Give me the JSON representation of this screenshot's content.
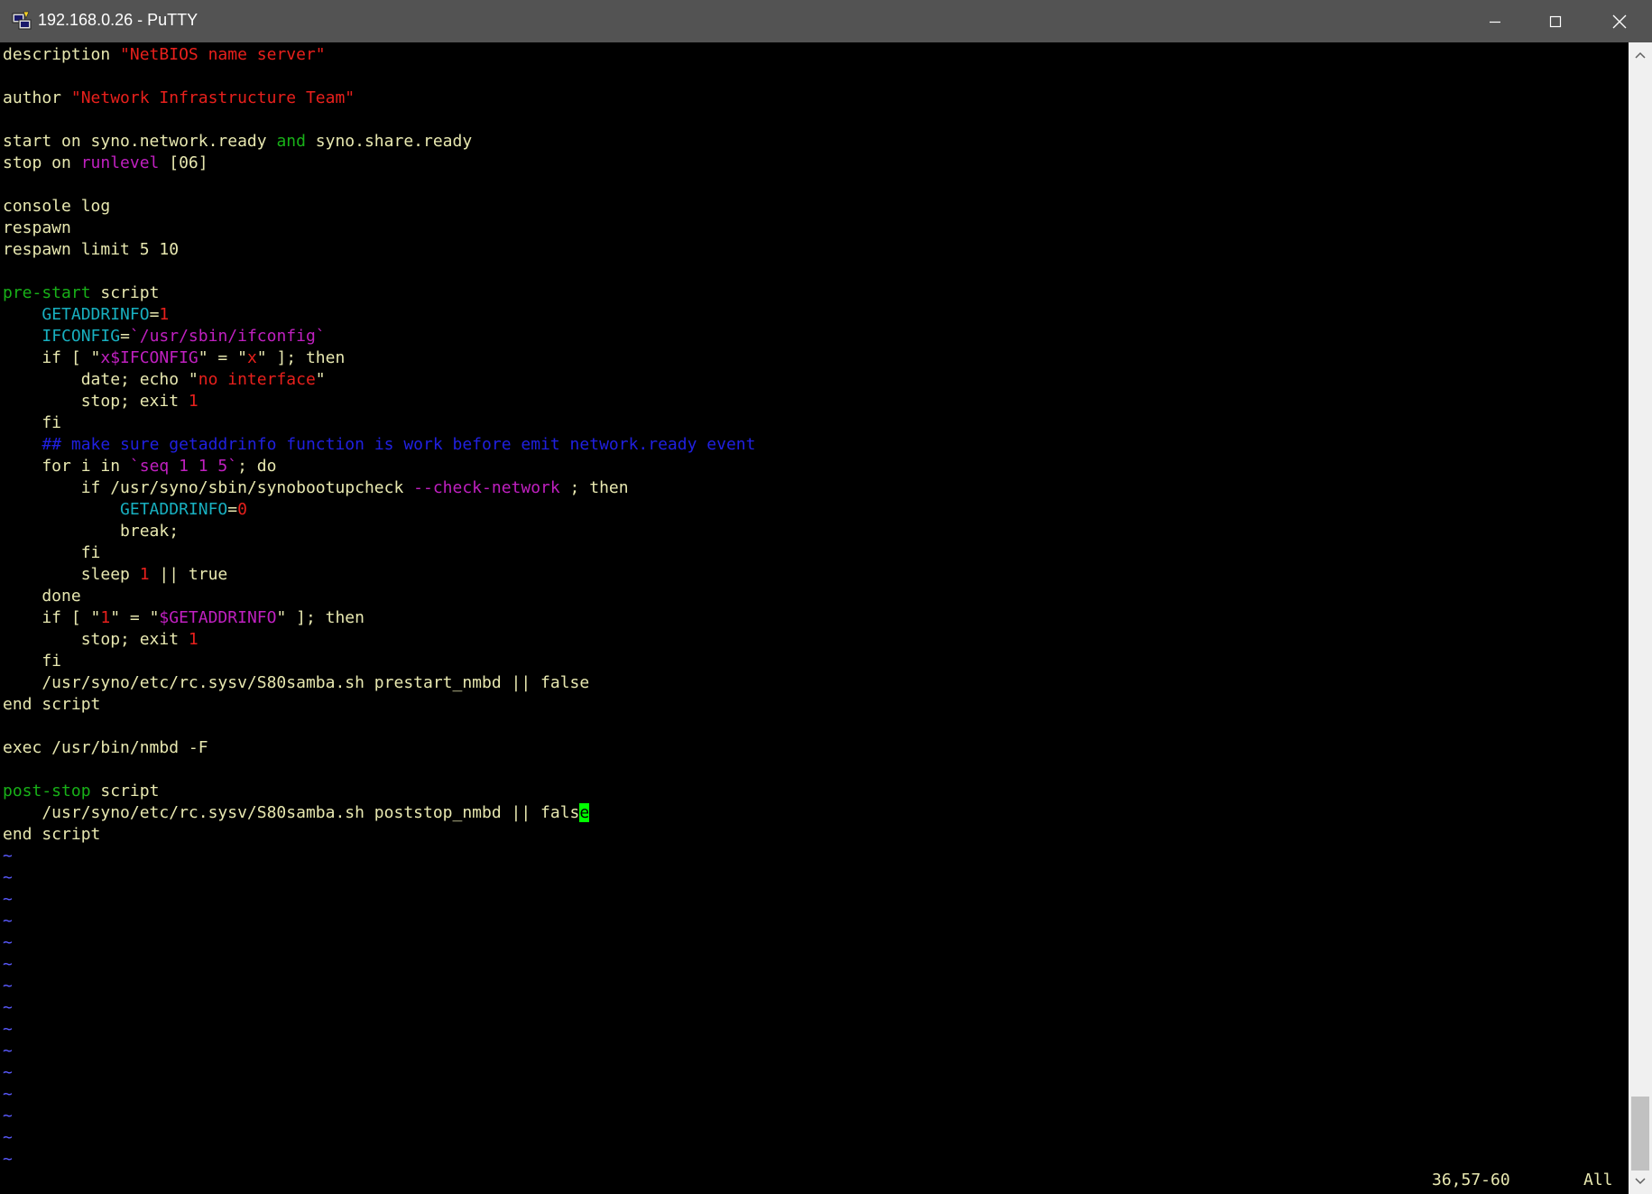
{
  "window": {
    "title": "192.168.0.26 - PuTTY",
    "icon": "putty-icon"
  },
  "colors": {
    "background": "#000000",
    "default_text": "#e8e8b0",
    "string": "#e8201c",
    "keyword_green": "#18b018",
    "keyword_magenta": "#c020c0",
    "variable_cyan": "#18b0c0",
    "comment_blue": "#2020e0",
    "tilde_blue": "#5a5aff",
    "cursor": "#00ff00",
    "titlebar": "#535353"
  },
  "editor": {
    "lines": [
      [
        {
          "t": "description ",
          "c": "d"
        },
        {
          "t": "\"NetBIOS name server\"",
          "c": "s"
        }
      ],
      [],
      [
        {
          "t": "author ",
          "c": "d"
        },
        {
          "t": "\"Network Infrastructure Team\"",
          "c": "s"
        }
      ],
      [],
      [
        {
          "t": "start on syno.network.ready ",
          "c": "d"
        },
        {
          "t": "and",
          "c": "g"
        },
        {
          "t": " syno.share.ready",
          "c": "d"
        }
      ],
      [
        {
          "t": "stop on ",
          "c": "d"
        },
        {
          "t": "runlevel",
          "c": "m"
        },
        {
          "t": " [06]",
          "c": "d"
        }
      ],
      [],
      [
        {
          "t": "console log",
          "c": "d"
        }
      ],
      [
        {
          "t": "respawn",
          "c": "d"
        }
      ],
      [
        {
          "t": "respawn limit 5 10",
          "c": "d"
        }
      ],
      [],
      [
        {
          "t": "pre-start",
          "c": "g"
        },
        {
          "t": " script",
          "c": "d"
        }
      ],
      [
        {
          "t": "    ",
          "c": "d"
        },
        {
          "t": "GETADDRINFO",
          "c": "c"
        },
        {
          "t": "=",
          "c": "d"
        },
        {
          "t": "1",
          "c": "s"
        }
      ],
      [
        {
          "t": "    ",
          "c": "d"
        },
        {
          "t": "IFCONFIG",
          "c": "c"
        },
        {
          "t": "=",
          "c": "d"
        },
        {
          "t": "`/usr/sbin/ifconfig`",
          "c": "m"
        }
      ],
      [
        {
          "t": "    if [ \"",
          "c": "d"
        },
        {
          "t": "x$IFCONFIG",
          "c": "m"
        },
        {
          "t": "\" = \"",
          "c": "d"
        },
        {
          "t": "x",
          "c": "s"
        },
        {
          "t": "\" ]; then",
          "c": "d"
        }
      ],
      [
        {
          "t": "        date; echo \"",
          "c": "d"
        },
        {
          "t": "no interface",
          "c": "s"
        },
        {
          "t": "\"",
          "c": "d"
        }
      ],
      [
        {
          "t": "        stop; exit ",
          "c": "d"
        },
        {
          "t": "1",
          "c": "s"
        }
      ],
      [
        {
          "t": "    fi",
          "c": "d"
        }
      ],
      [
        {
          "t": "    ",
          "c": "d"
        },
        {
          "t": "## make sure getaddrinfo function is work before emit network.ready event",
          "c": "b"
        }
      ],
      [
        {
          "t": "    for i in ",
          "c": "d"
        },
        {
          "t": "`seq 1 1 5`",
          "c": "m"
        },
        {
          "t": "; do",
          "c": "d"
        }
      ],
      [
        {
          "t": "        if /usr/syno/sbin/synobootupcheck ",
          "c": "d"
        },
        {
          "t": "--check-network",
          "c": "m"
        },
        {
          "t": " ; then",
          "c": "d"
        }
      ],
      [
        {
          "t": "            ",
          "c": "d"
        },
        {
          "t": "GETADDRINFO",
          "c": "c"
        },
        {
          "t": "=",
          "c": "d"
        },
        {
          "t": "0",
          "c": "s"
        }
      ],
      [
        {
          "t": "            break;",
          "c": "d"
        }
      ],
      [
        {
          "t": "        fi",
          "c": "d"
        }
      ],
      [
        {
          "t": "        sleep ",
          "c": "d"
        },
        {
          "t": "1",
          "c": "s"
        },
        {
          "t": " || true",
          "c": "d"
        }
      ],
      [
        {
          "t": "    done",
          "c": "d"
        }
      ],
      [
        {
          "t": "    if [ \"",
          "c": "d"
        },
        {
          "t": "1",
          "c": "s"
        },
        {
          "t": "\" = \"",
          "c": "d"
        },
        {
          "t": "$GETADDRINFO",
          "c": "m"
        },
        {
          "t": "\" ]; then",
          "c": "d"
        }
      ],
      [
        {
          "t": "        stop; exit ",
          "c": "d"
        },
        {
          "t": "1",
          "c": "s"
        }
      ],
      [
        {
          "t": "    fi",
          "c": "d"
        }
      ],
      [
        {
          "t": "    /usr/syno/etc/rc.sysv/S80samba.sh prestart_nmbd || false",
          "c": "d"
        }
      ],
      [
        {
          "t": "end script",
          "c": "d"
        }
      ],
      [],
      [
        {
          "t": "exec /usr/bin/nmbd -F",
          "c": "d"
        }
      ],
      [],
      [
        {
          "t": "post-stop",
          "c": "g"
        },
        {
          "t": " script",
          "c": "d"
        }
      ],
      [
        {
          "t": "    /usr/syno/etc/rc.sysv/S80samba.sh poststop_nmbd || fals",
          "c": "d"
        },
        {
          "t": "e",
          "c": "cursor"
        }
      ],
      [
        {
          "t": "end script",
          "c": "d"
        }
      ]
    ],
    "tilde_lines": 15,
    "tilde": "~",
    "status_position": "36,57-60",
    "status_scroll": "All"
  }
}
